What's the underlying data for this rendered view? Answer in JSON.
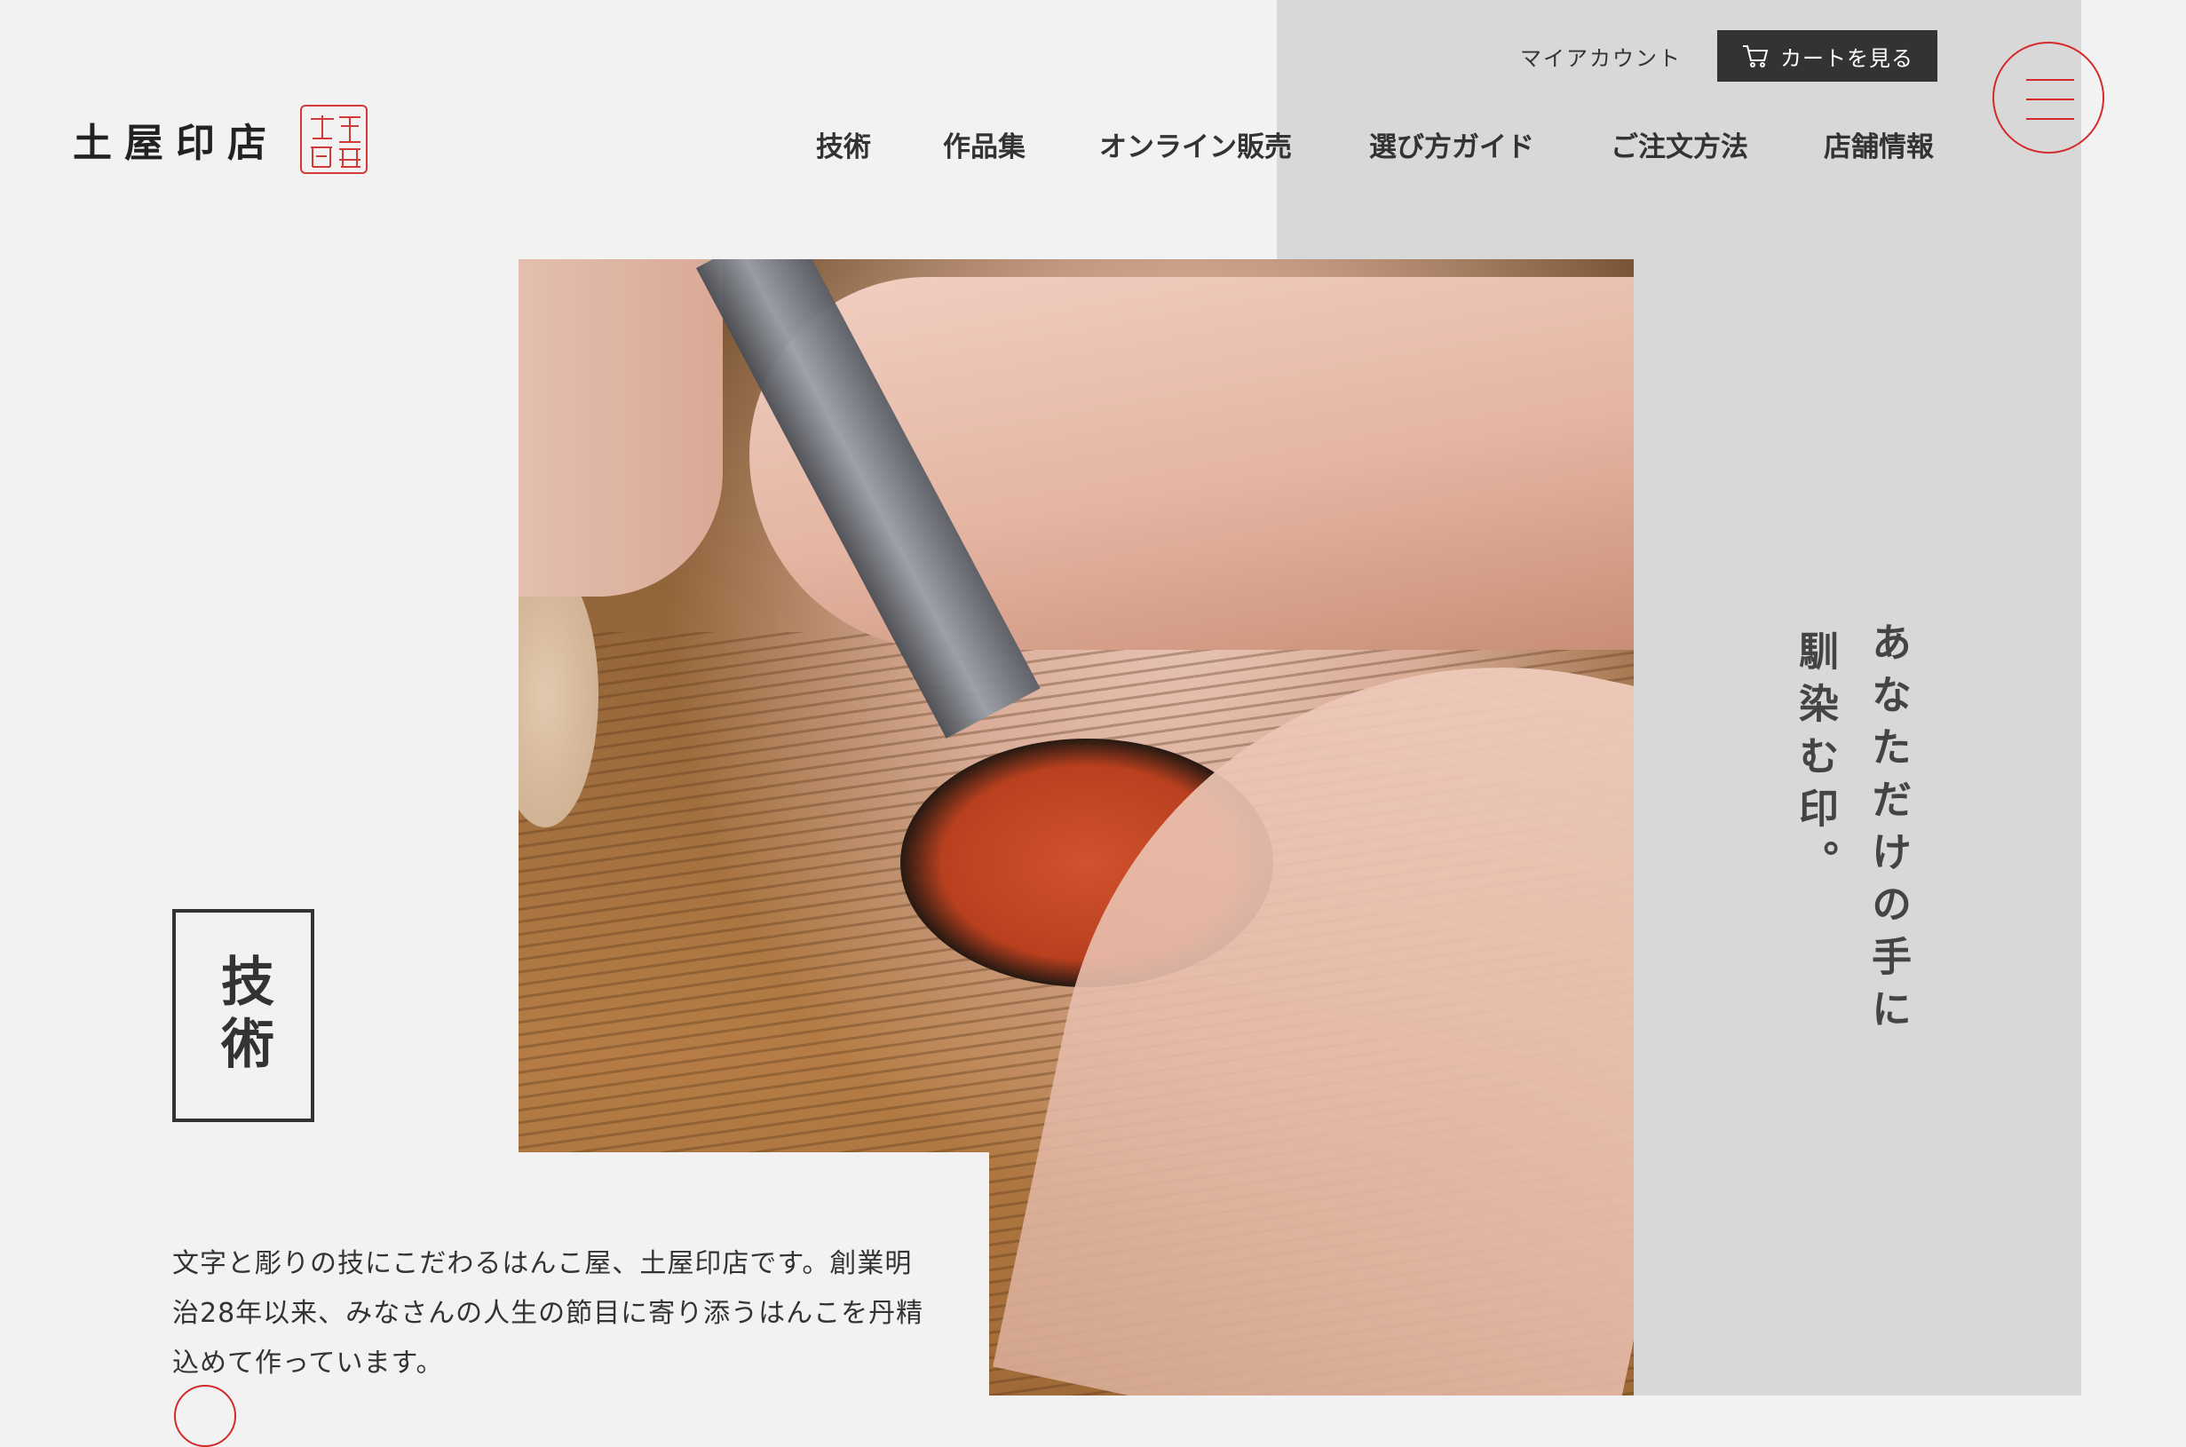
{
  "header": {
    "logo_text": "土屋印店",
    "account_link": "マイアカウント",
    "cart_button": "カートを見る",
    "nav": [
      {
        "label": "技術"
      },
      {
        "label": "作品集"
      },
      {
        "label": "オンライン販売"
      },
      {
        "label": "選び方ガイド"
      },
      {
        "label": "ご注文方法"
      },
      {
        "label": "店舗情報"
      }
    ],
    "menu_icon": "hamburger-icon",
    "cart_icon": "cart-icon"
  },
  "hero": {
    "tagline_line1": "あなただけの手に",
    "tagline_line2": "馴染む印。",
    "photo_alt": "seal-carving-photo"
  },
  "section": {
    "heading": "技術",
    "intro": "文字と彫りの技にこだわるはんこ屋、土屋印店です。創業明治28年以来、みなさんの人生の節目に寄り添うはんこを丹精込めて作っています。"
  },
  "colors": {
    "accent": "#d42a2a",
    "text": "#333333",
    "background": "#f2f2f2",
    "band": "#d8d8d8",
    "cart_bg": "#333333"
  }
}
